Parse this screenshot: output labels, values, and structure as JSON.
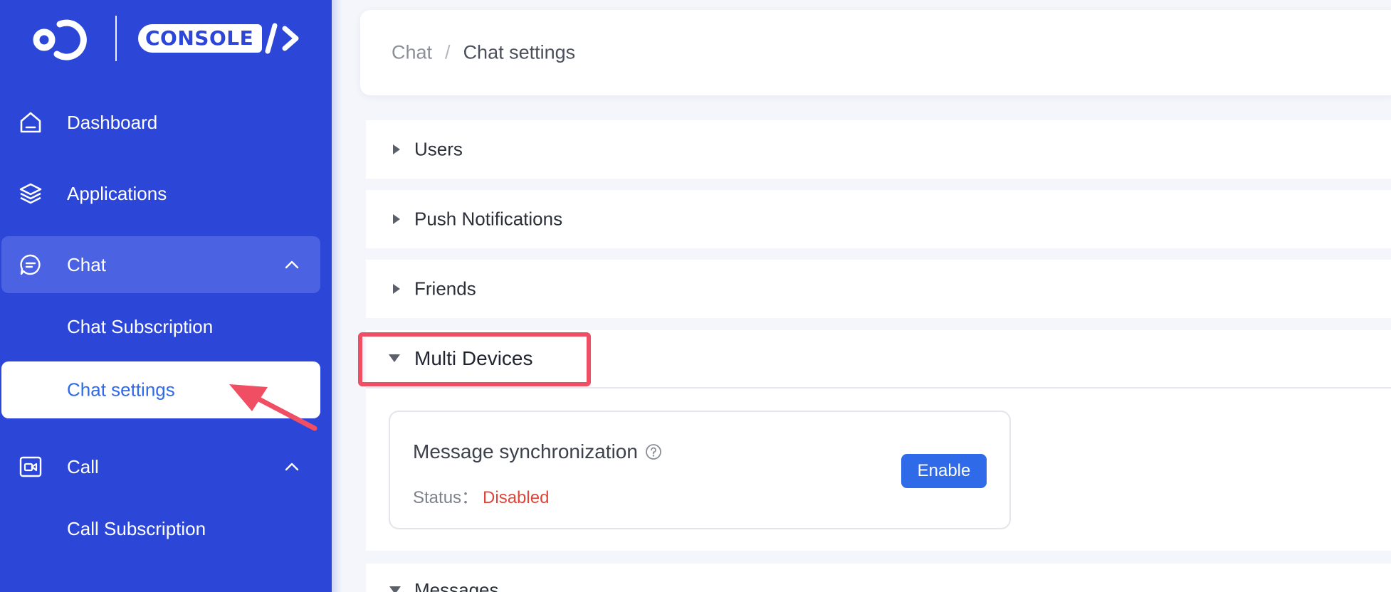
{
  "sidebar": {
    "logo_text": "CONSOLE",
    "items": [
      {
        "label": "Dashboard",
        "icon": "home-icon"
      },
      {
        "label": "Applications",
        "icon": "layers-icon"
      },
      {
        "label": "Chat",
        "icon": "chat-bubble-icon",
        "expanded": true
      },
      {
        "label": "Call",
        "icon": "video-call-icon",
        "expanded": true
      }
    ],
    "chat_sub_items": [
      "Chat Subscription",
      "Chat settings"
    ],
    "call_sub_items": [
      "Call Subscription"
    ],
    "active_sub_item": "Chat settings"
  },
  "breadcrumb": {
    "parent": "Chat",
    "separator": "/",
    "current": "Chat settings"
  },
  "sections": [
    {
      "label": "Users",
      "expanded": false
    },
    {
      "label": "Push Notifications",
      "expanded": false
    },
    {
      "label": "Friends",
      "expanded": false
    },
    {
      "label": "Multi Devices",
      "expanded": true
    },
    {
      "label": "Messages",
      "expanded": true
    }
  ],
  "multi_devices": {
    "setting_title": "Message synchronization",
    "status_label": "Status：",
    "status_value": "Disabled",
    "action_label": "Enable"
  },
  "colors": {
    "sidebar_bg": "#2c47d8",
    "accent": "#2f6ae8",
    "status_disabled": "#e04438",
    "highlight": "#f04e63"
  }
}
